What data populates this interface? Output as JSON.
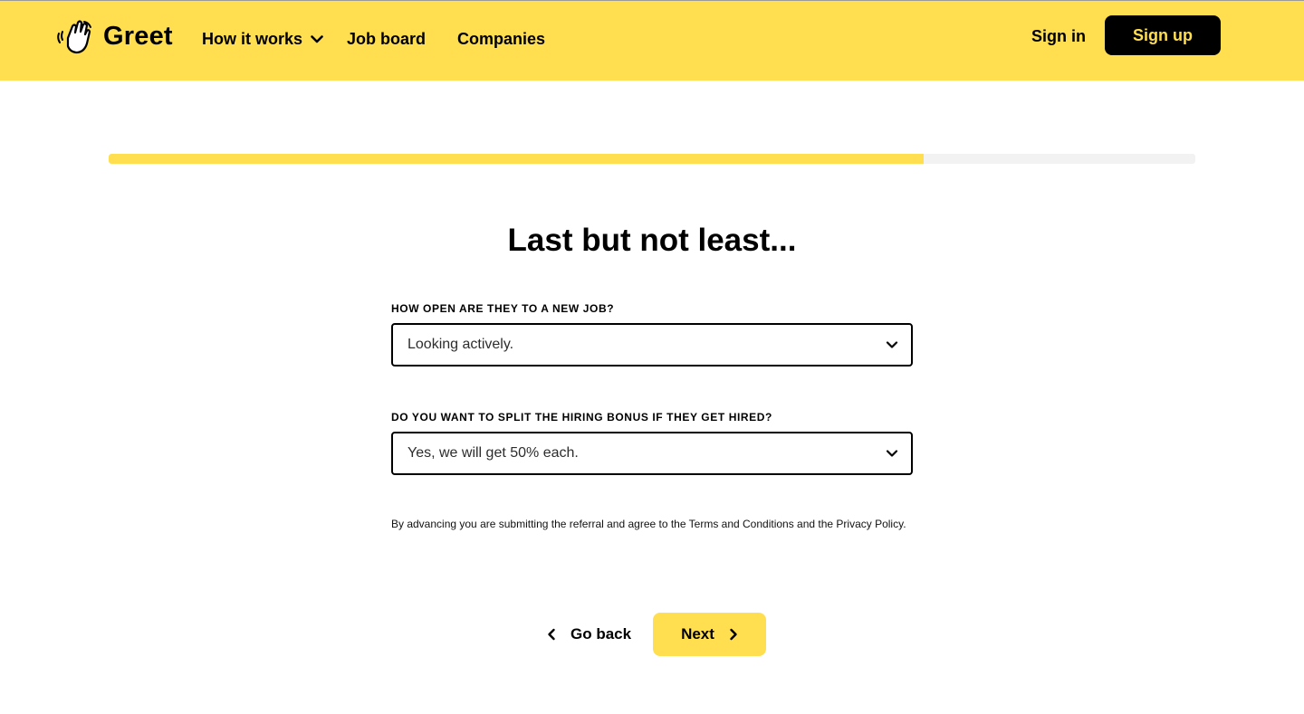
{
  "header": {
    "brand": "Greet",
    "logo_icon": "waving-hand-icon",
    "nav": {
      "how_it_works": "How it works",
      "job_board": "Job board",
      "companies": "Companies"
    },
    "sign_in": "Sign in",
    "sign_up": "Sign up"
  },
  "progress": {
    "fraction": 0.75
  },
  "form": {
    "title": "Last but not least...",
    "openness": {
      "label": "HOW OPEN ARE THEY TO A NEW JOB?",
      "value": "Looking actively."
    },
    "bonus_split": {
      "label": "DO YOU WANT TO SPLIT THE HIRING BONUS IF THEY GET HIRED?",
      "value": "Yes, we will get 50% each."
    },
    "disclaimer": "By advancing you are submitting the referral and agree to the Terms and Conditions and the Privacy Policy."
  },
  "actions": {
    "back": "Go back",
    "next": "Next"
  },
  "colors": {
    "brand_yellow": "#ffdf4f",
    "dark": "#000000",
    "track": "#f2f2f2"
  }
}
